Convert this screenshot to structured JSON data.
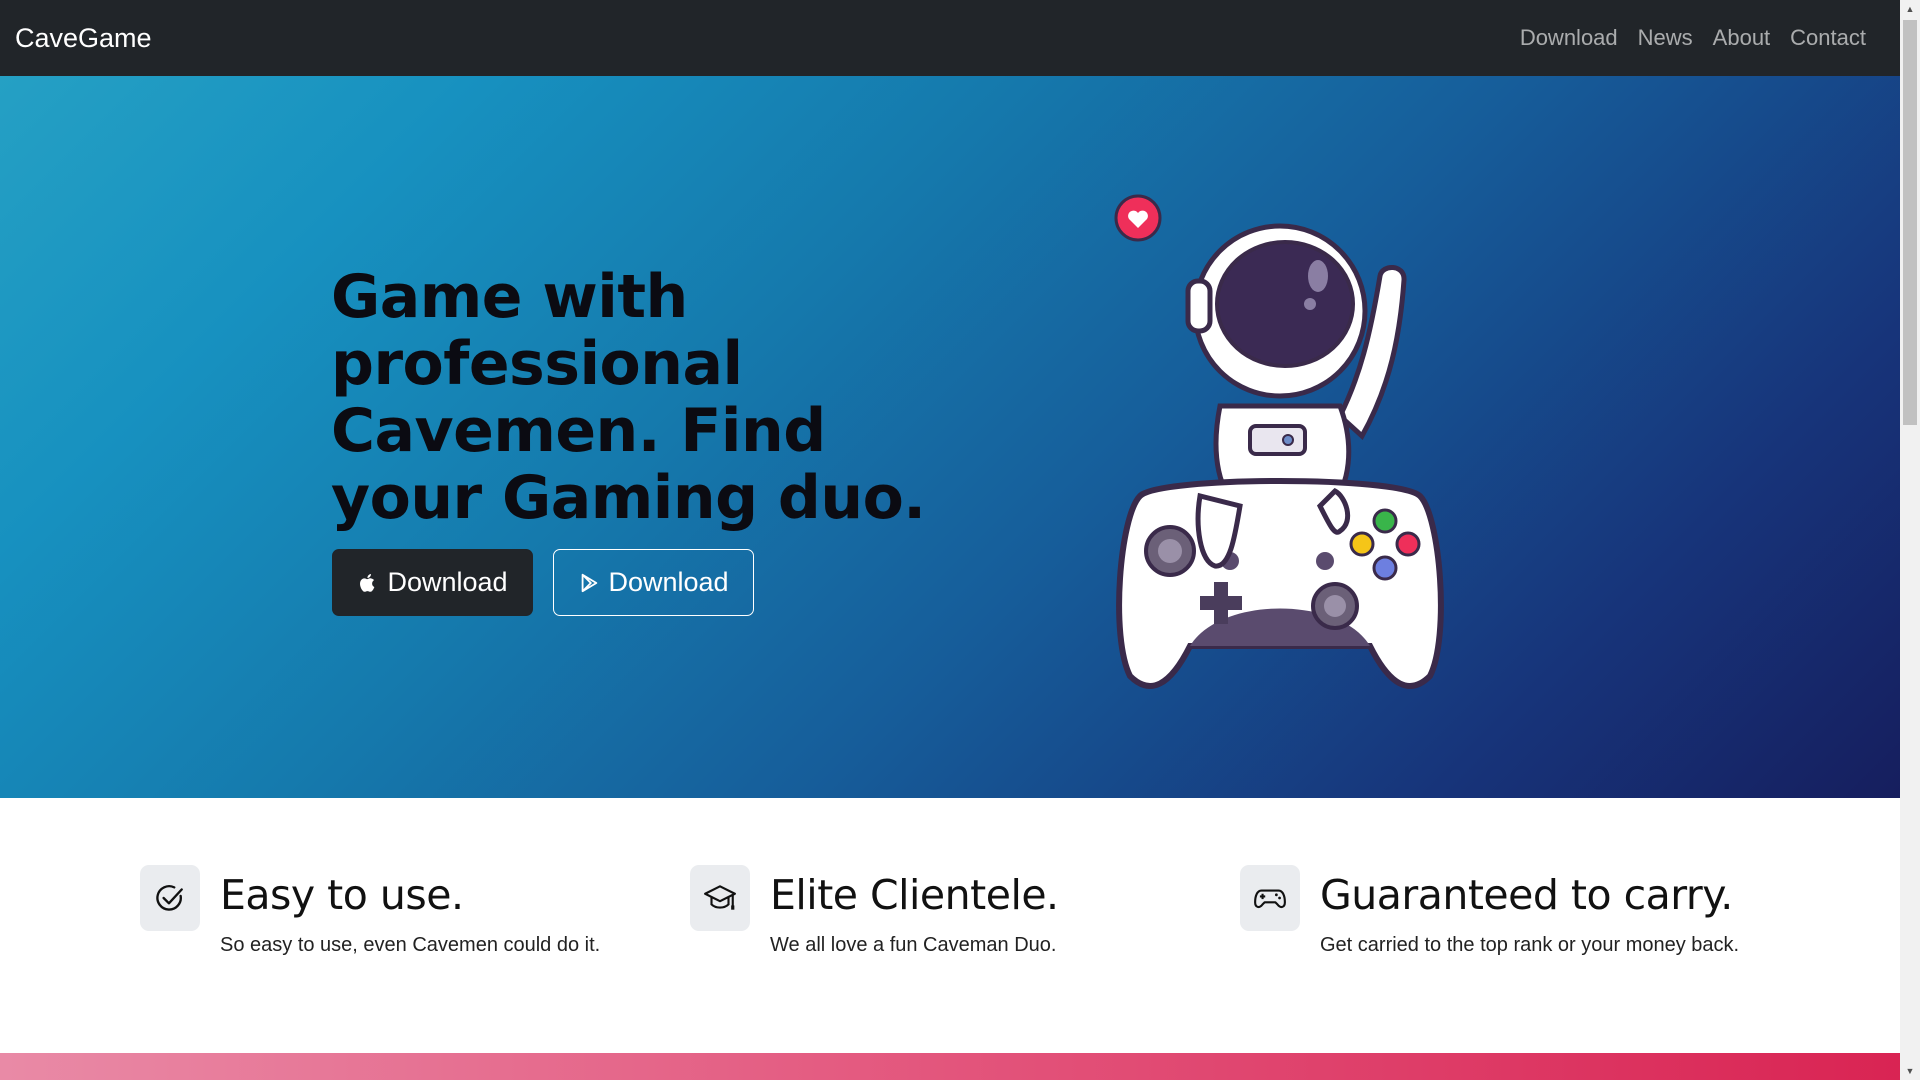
{
  "nav": {
    "brand": "CaveGame",
    "links": [
      "Download",
      "News",
      "About",
      "Contact"
    ]
  },
  "hero": {
    "title": "Game with professional Cavemen. Find your Gaming duo.",
    "buttons": [
      {
        "label": "Download",
        "icon": "apple-icon"
      },
      {
        "label": "Download",
        "icon": "google-play-icon"
      }
    ],
    "illustration": "astronaut-gamepad-illustration"
  },
  "features": [
    {
      "title": "Easy to use.",
      "text": "So easy to use, even Cavemen could do it.",
      "icon": "check-circle-icon"
    },
    {
      "title": "Elite Clientele.",
      "text": "We all love a fun Caveman Duo.",
      "icon": "graduation-cap-icon"
    },
    {
      "title": "Guaranteed to carry.",
      "text": "Get carried to the top rank or your money back.",
      "icon": "controller-icon"
    }
  ],
  "colors": {
    "navbar": "#212529",
    "hero_start": "#25a0c4",
    "hero_end": "#161e5e",
    "band_accent": "#d92453"
  }
}
